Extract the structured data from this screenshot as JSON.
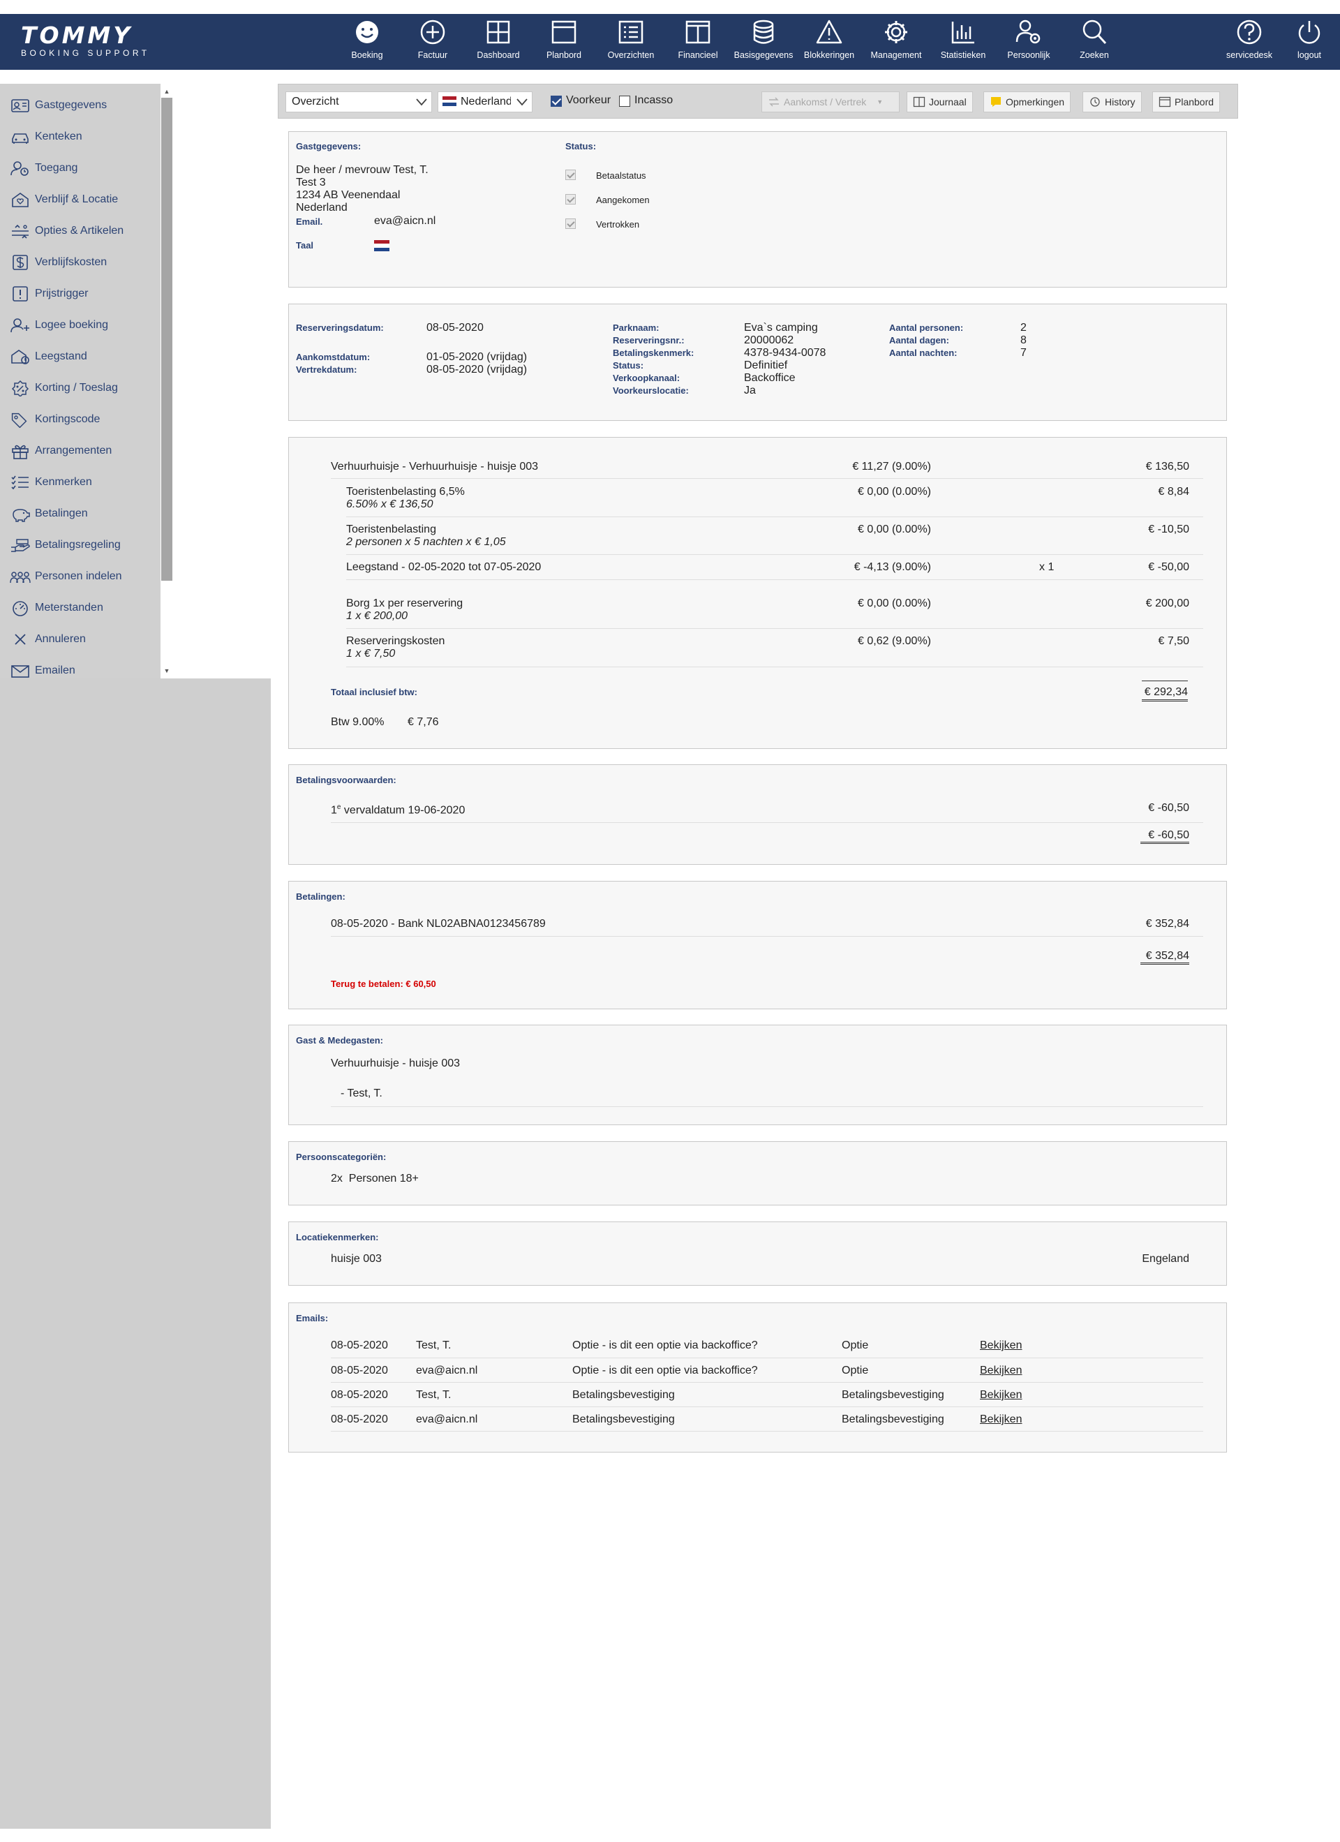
{
  "brand": {
    "name": "TOMMY",
    "subtitle": "BOOKING SUPPORT"
  },
  "nav": [
    {
      "label": "Boeking",
      "icon": "smiley-icon"
    },
    {
      "label": "Factuur",
      "icon": "plus-circle-icon"
    },
    {
      "label": "Dashboard",
      "icon": "grid-icon"
    },
    {
      "label": "Planbord",
      "icon": "window-icon"
    },
    {
      "label": "Overzichten",
      "icon": "list-icon"
    },
    {
      "label": "Financieel",
      "icon": "book-icon"
    },
    {
      "label": "Basisgegevens",
      "icon": "database-icon"
    },
    {
      "label": "Blokkeringen",
      "icon": "warning-icon"
    },
    {
      "label": "Management",
      "icon": "gear-icon"
    },
    {
      "label": "Statistieken",
      "icon": "bar-chart-icon"
    },
    {
      "label": "Persoonlijk",
      "icon": "user-gear-icon"
    },
    {
      "label": "Zoeken",
      "icon": "search-icon"
    }
  ],
  "nav_right": [
    {
      "label": "servicedesk",
      "icon": "help-icon"
    },
    {
      "label": "logout",
      "icon": "power-icon"
    }
  ],
  "sidebar": [
    "Gastgegevens",
    "Kenteken",
    "Toegang",
    "Verblijf & Locatie",
    "Opties & Artikelen",
    "Verblijfskosten",
    "Prijstrigger",
    "Logee boeking",
    "Leegstand",
    "Korting / Toeslag",
    "Kortingscode",
    "Arrangementen",
    "Kenmerken",
    "Betalingen",
    "Betalingsregeling",
    "Personen indelen",
    "Meterstanden",
    "Annuleren",
    "Emailen"
  ],
  "toolbar": {
    "view_select": "Overzicht",
    "language_select": "Nederlands",
    "voorkeur_label": "Voorkeur",
    "incasso_label": "Incasso",
    "arrival_btn": "Aankomst / Vertrek",
    "journaal_btn": "Journaal",
    "opmerkingen_btn": "Opmerkingen",
    "history_btn": "History",
    "planbord_btn": "Planbord"
  },
  "guest": {
    "title": "Gastgegevens:",
    "name": "De heer / mevrouw Test, T.",
    "street": "Test 3",
    "city": "1234 AB Veenendaal",
    "country": "Nederland",
    "email_label": "Email.",
    "email": "eva@aicn.nl",
    "taal_label": "Taal",
    "status_title": "Status:",
    "status": [
      "Betaalstatus",
      "Aangekomen",
      "Vertrokken"
    ]
  },
  "reservation": {
    "res_date_label": "Reserveringsdatum:",
    "res_date": "08-05-2020",
    "arrival_label": "Aankomstdatum:",
    "arrival": "01-05-2020 (vrijdag)",
    "departure_label": "Vertrekdatum:",
    "departure": "08-05-2020 (vrijdag)",
    "park_labels": [
      "Parknaam:",
      "Reserveringsnr.:",
      "Betalingskenmerk:",
      "Status:",
      "Verkoopkanaal:",
      "Voorkeurslocatie:"
    ],
    "park_values": [
      "Eva`s camping",
      "20000062",
      "4378-9434-0078",
      "Definitief",
      "Backoffice",
      "Ja"
    ],
    "count_labels": [
      "Aantal personen:",
      "Aantal dagen:",
      "Aantal nachten:"
    ],
    "count_values": [
      "2",
      "8",
      "7"
    ]
  },
  "costs": {
    "lines": [
      {
        "desc": "Verhuurhuisje - Verhuurhuisje - huisje 003",
        "sub": "",
        "tax": "€ 11,27 (9.00%)",
        "qty": "",
        "amount": "€ 136,50"
      },
      {
        "desc": "Toeristenbelasting 6,5%",
        "sub": "6.50% x € 136,50",
        "tax": "€ 0,00 (0.00%)",
        "qty": "",
        "amount": "€ 8,84"
      },
      {
        "desc": "Toeristenbelasting",
        "sub": "2 personen x 5 nachten x € 1,05",
        "tax": "€ 0,00 (0.00%)",
        "qty": "",
        "amount": "€ -10,50"
      },
      {
        "desc": "Leegstand - 02-05-2020 tot 07-05-2020",
        "sub": "",
        "tax": "€ -4,13 (9.00%)",
        "qty": "x 1",
        "amount": "€ -50,00"
      },
      {
        "desc": "Borg 1x per reservering",
        "sub": "1 x € 200,00",
        "tax": "€ 0,00 (0.00%)",
        "qty": "",
        "amount": "€ 200,00"
      },
      {
        "desc": "Reserveringskosten",
        "sub": "1 x € 7,50",
        "tax": "€ 0,62 (9.00%)",
        "qty": "",
        "amount": "€ 7,50"
      }
    ],
    "total_label": "Totaal inclusief btw:",
    "total": "€ 292,34",
    "btw_label": "Btw 9.00%",
    "btw_value": "€ 7,76"
  },
  "conditions": {
    "title": "Betalingsvoorwaarden:",
    "line_prefix": "1",
    "line_sup": "e",
    "line_rest": " vervaldatum 19-06-2020",
    "amount": "€ -60,50",
    "total": "€ -60,50"
  },
  "payments": {
    "title": "Betalingen:",
    "line": "08-05-2020 - Bank NL02ABNA0123456789",
    "amount": "€ 352,84",
    "total": "€ 352,84",
    "refund": "Terug te betalen: € 60,50"
  },
  "guests": {
    "title": "Gast & Medegasten:",
    "accommodation": "Verhuurhuisje - huisje 003",
    "guest": "- Test, T."
  },
  "categories": {
    "title": "Persoonscategoriën:",
    "line": "2x  Personen 18+"
  },
  "location": {
    "title": "Locatiekenmerken:",
    "name": "huisje 003",
    "value": "Engeland"
  },
  "emails": {
    "title": "Emails:",
    "rows": [
      {
        "date": "08-05-2020",
        "to": "Test, T.",
        "subject": "Optie - is dit een optie via backoffice?",
        "type": "Optie",
        "action": "Bekijken"
      },
      {
        "date": "08-05-2020",
        "to": "eva@aicn.nl",
        "subject": "Optie - is dit een optie via backoffice?",
        "type": "Optie",
        "action": "Bekijken"
      },
      {
        "date": "08-05-2020",
        "to": "Test, T.",
        "subject": "Betalingsbevestiging",
        "type": "Betalingsbevestiging",
        "action": "Bekijken"
      },
      {
        "date": "08-05-2020",
        "to": "eva@aicn.nl",
        "subject": "Betalingsbevestiging",
        "type": "Betalingsbevestiging",
        "action": "Bekijken"
      }
    ]
  },
  "colors": {
    "nav_bg": "#243a64",
    "sidebar_text": "#2c4374",
    "refund": "#d40000"
  }
}
